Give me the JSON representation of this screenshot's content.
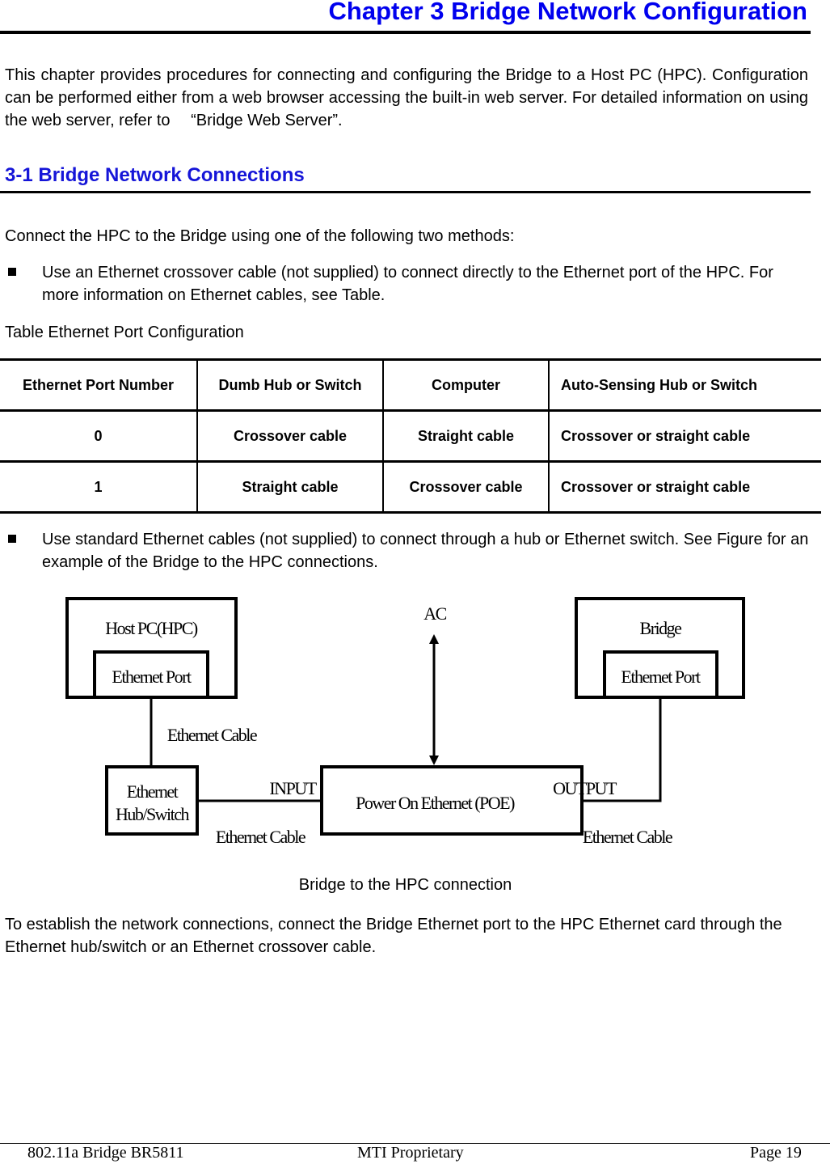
{
  "chapter_title": "Chapter 3 Bridge Network Configuration",
  "intro_paragraph": "This chapter provides procedures for connecting and configuring the Bridge to a Host PC (HPC). Configuration can be performed either from a web browser accessing the built-in web server. For detailed information on using the web server, refer to 　“Bridge Web Server”.",
  "section_title": "3-1 Bridge Network Connections",
  "connect_intro": "Connect the HPC to the Bridge using one of the following two methods:",
  "bullets": [
    "Use an Ethernet crossover cable (not supplied) to connect directly to the Ethernet port of the HPC. For more information on Ethernet cables, see Table.",
    "Use standard Ethernet cables (not supplied) to connect through a hub or Ethernet switch. See Figure for an example of the Bridge to the HPC connections."
  ],
  "table_caption": "Table Ethernet Port Configuration",
  "table": {
    "headers": [
      "Ethernet Port Number",
      "Dumb Hub or Switch",
      "Computer",
      "Auto-Sensing Hub or Switch"
    ],
    "rows": [
      [
        "0",
        "Crossover cable",
        "Straight cable",
        "Crossover or straight cable"
      ],
      [
        "1",
        "Straight cable",
        "Crossover cable",
        "Crossover or straight cable"
      ]
    ]
  },
  "diagram": {
    "host_pc": "Host PC(HPC)",
    "host_port": "Ethernet Port",
    "bridge": "Bridge",
    "bridge_port": "Ethernet Port",
    "ac": "AC",
    "hub_line1": "Ethernet",
    "hub_line2": "Hub/Switch",
    "poe": "Power  On Ethernet (POE)",
    "input": "INPUT",
    "output": "OUTPUT",
    "cable_vertical": "Ethernet Cable",
    "cable_input": "Ethernet Cable",
    "cable_output": "Ethernet Cable"
  },
  "figure_caption": "Bridge to the HPC connection",
  "closing_paragraph": "To establish the network connections, connect the Bridge Ethernet port to the HPC Ethernet card through the Ethernet hub/switch or an Ethernet crossover cable.",
  "footer": {
    "left": "802.11a Bridge BR5811",
    "center": "MTI Proprietary",
    "right": "Page 19"
  }
}
